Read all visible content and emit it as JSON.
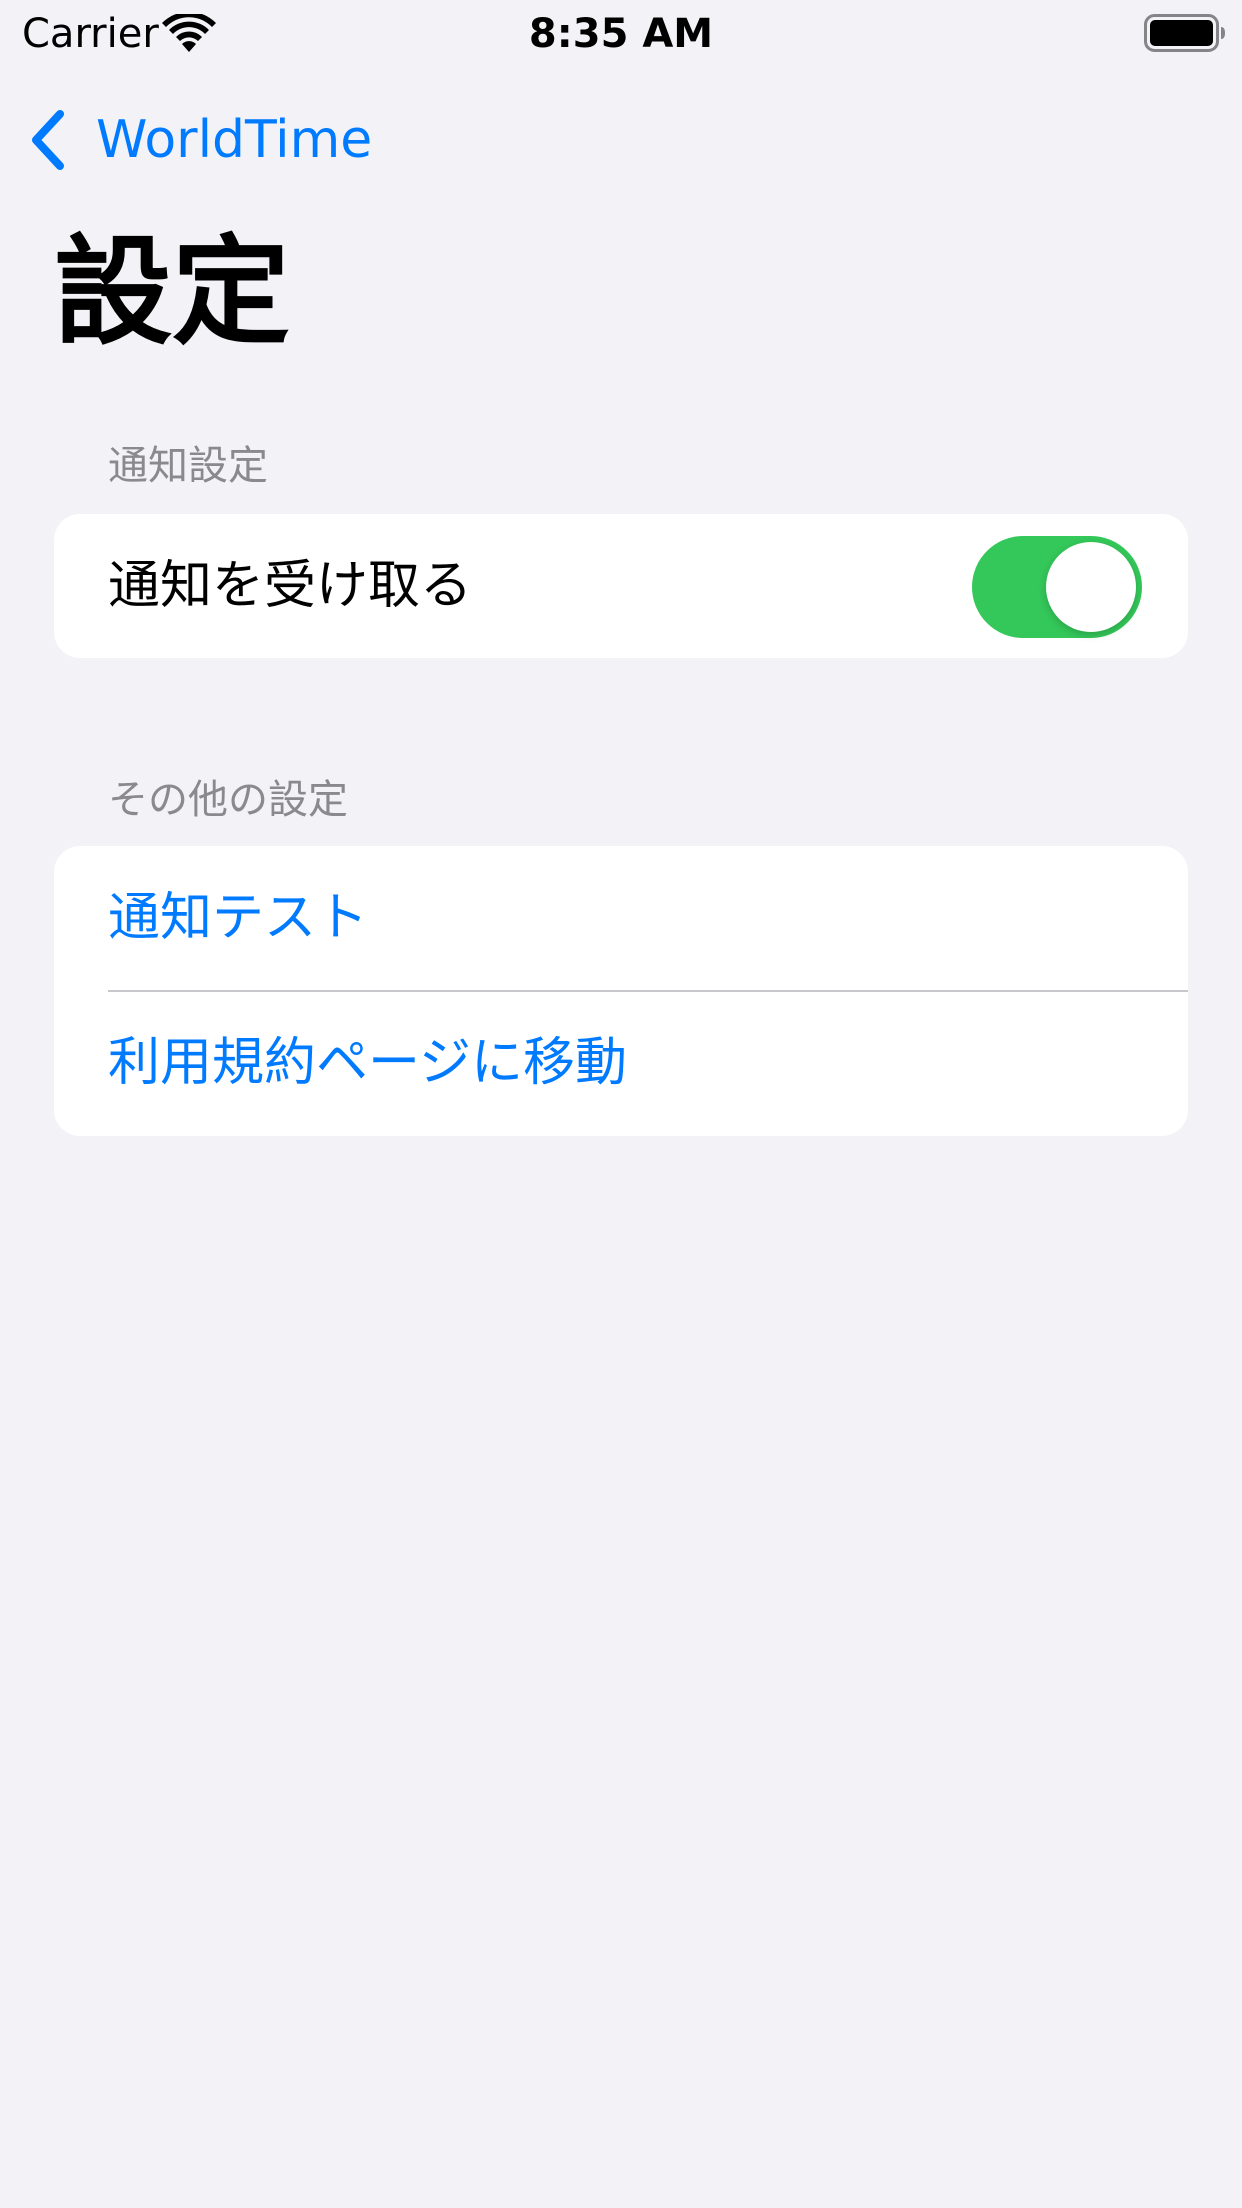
{
  "status_bar": {
    "carrier": "Carrier",
    "time": "8:35 AM"
  },
  "nav": {
    "back_label": "WorldTime"
  },
  "page": {
    "title": "設定"
  },
  "sections": [
    {
      "header": "通知設定",
      "rows": [
        {
          "label": "通知を受け取る",
          "toggle_on": true
        }
      ]
    },
    {
      "header": "その他の設定",
      "rows": [
        {
          "label": "通知テスト"
        },
        {
          "label": "利用規約ページに移動"
        }
      ]
    }
  ],
  "colors": {
    "accent": "#007aff",
    "toggle_on": "#34c759",
    "background": "#f2f2f7",
    "section_header": "#8a8a8e"
  }
}
